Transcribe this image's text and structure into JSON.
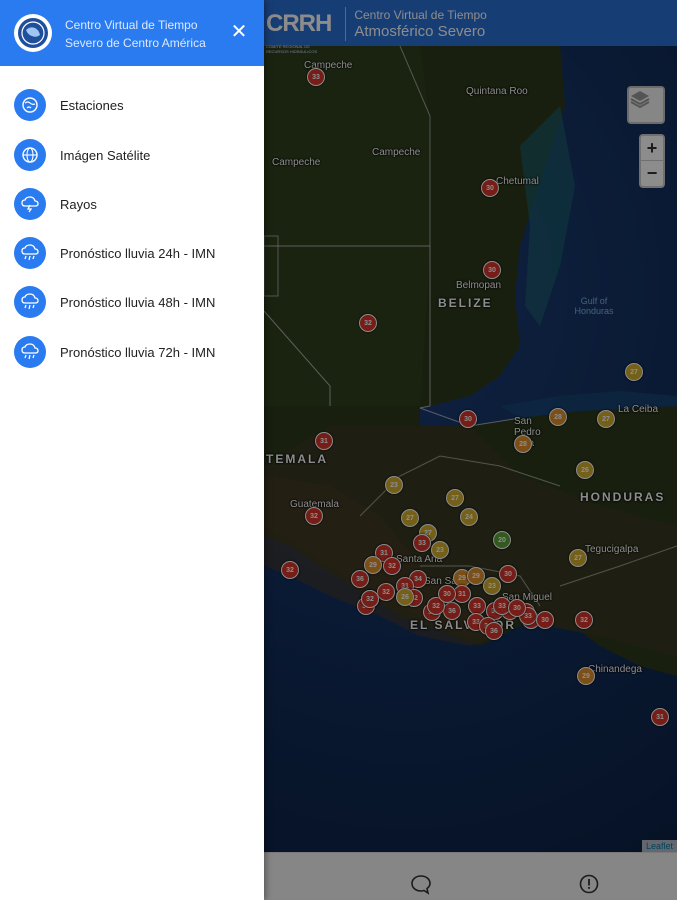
{
  "appbar": {
    "logo": "CRRH",
    "logo_sub": "COMITÉ REGIONAL DE RECURSOS HIDRÁULICOS",
    "title_line1": "Centro Virtual de Tiempo",
    "title_line2": "Atmosférico Severo"
  },
  "drawer": {
    "title": "Centro Virtual de Tiempo Severo de Centro América",
    "close_icon": "close-icon",
    "items": [
      {
        "label": "Estaciones",
        "icon": "globe-icon"
      },
      {
        "label": "Imágen Satélite",
        "icon": "satellite-globe-icon"
      },
      {
        "label": "Rayos",
        "icon": "cloud-lightning-icon"
      },
      {
        "label": "Pronóstico lluvia 24h - IMN",
        "icon": "cloud-rain-icon"
      },
      {
        "label": "Pronóstico lluvia 48h - IMN",
        "icon": "cloud-rain-icon"
      },
      {
        "label": "Pronóstico lluvia 72h - IMN",
        "icon": "cloud-rain-icon"
      }
    ]
  },
  "map": {
    "places": [
      "Campeche",
      "Quintana Roo",
      "Campeche",
      "Campeche",
      "Chetumal",
      "Belmopan",
      "San Pedro Sula",
      "La Ceiba",
      "Guatemala",
      "Tegucigalpa",
      "San Salvador",
      "Santa Ana",
      "San Miguel",
      "Chinandega"
    ],
    "countries": [
      "BELIZE",
      "TEMALA",
      "HONDURAS",
      "EL SALVADOR"
    ],
    "sea": "Gulf of Honduras",
    "zoom_in": "+",
    "zoom_out": "−",
    "attribution": "Leaflet",
    "markers": [
      "33",
      "30",
      "30",
      "32",
      "27",
      "30",
      "28",
      "27",
      "28",
      "26",
      "31",
      "23",
      "27",
      "32",
      "24",
      "27",
      "27",
      "20",
      "33",
      "31",
      "23",
      "29",
      "32",
      "36",
      "32",
      "34",
      "31",
      "29",
      "29",
      "23",
      "32",
      "32",
      "34",
      "36",
      "31",
      "33",
      "30",
      "33",
      "33",
      "31",
      "34",
      "33",
      "32",
      "32",
      "30",
      "33",
      "33",
      "30",
      "31",
      "36",
      "30",
      "32",
      "27",
      "31",
      "29",
      "26",
      "38",
      "32"
    ]
  },
  "bottombar": {
    "icons": [
      "chat-icon",
      "info-icon"
    ]
  },
  "colors": {
    "primary": "#2a7bf0",
    "appbar": "#2a6fd6",
    "marker_red": "#d9362b",
    "marker_orange": "#e0902a",
    "marker_yellow": "#d6b030",
    "marker_green": "#5ba43a"
  }
}
